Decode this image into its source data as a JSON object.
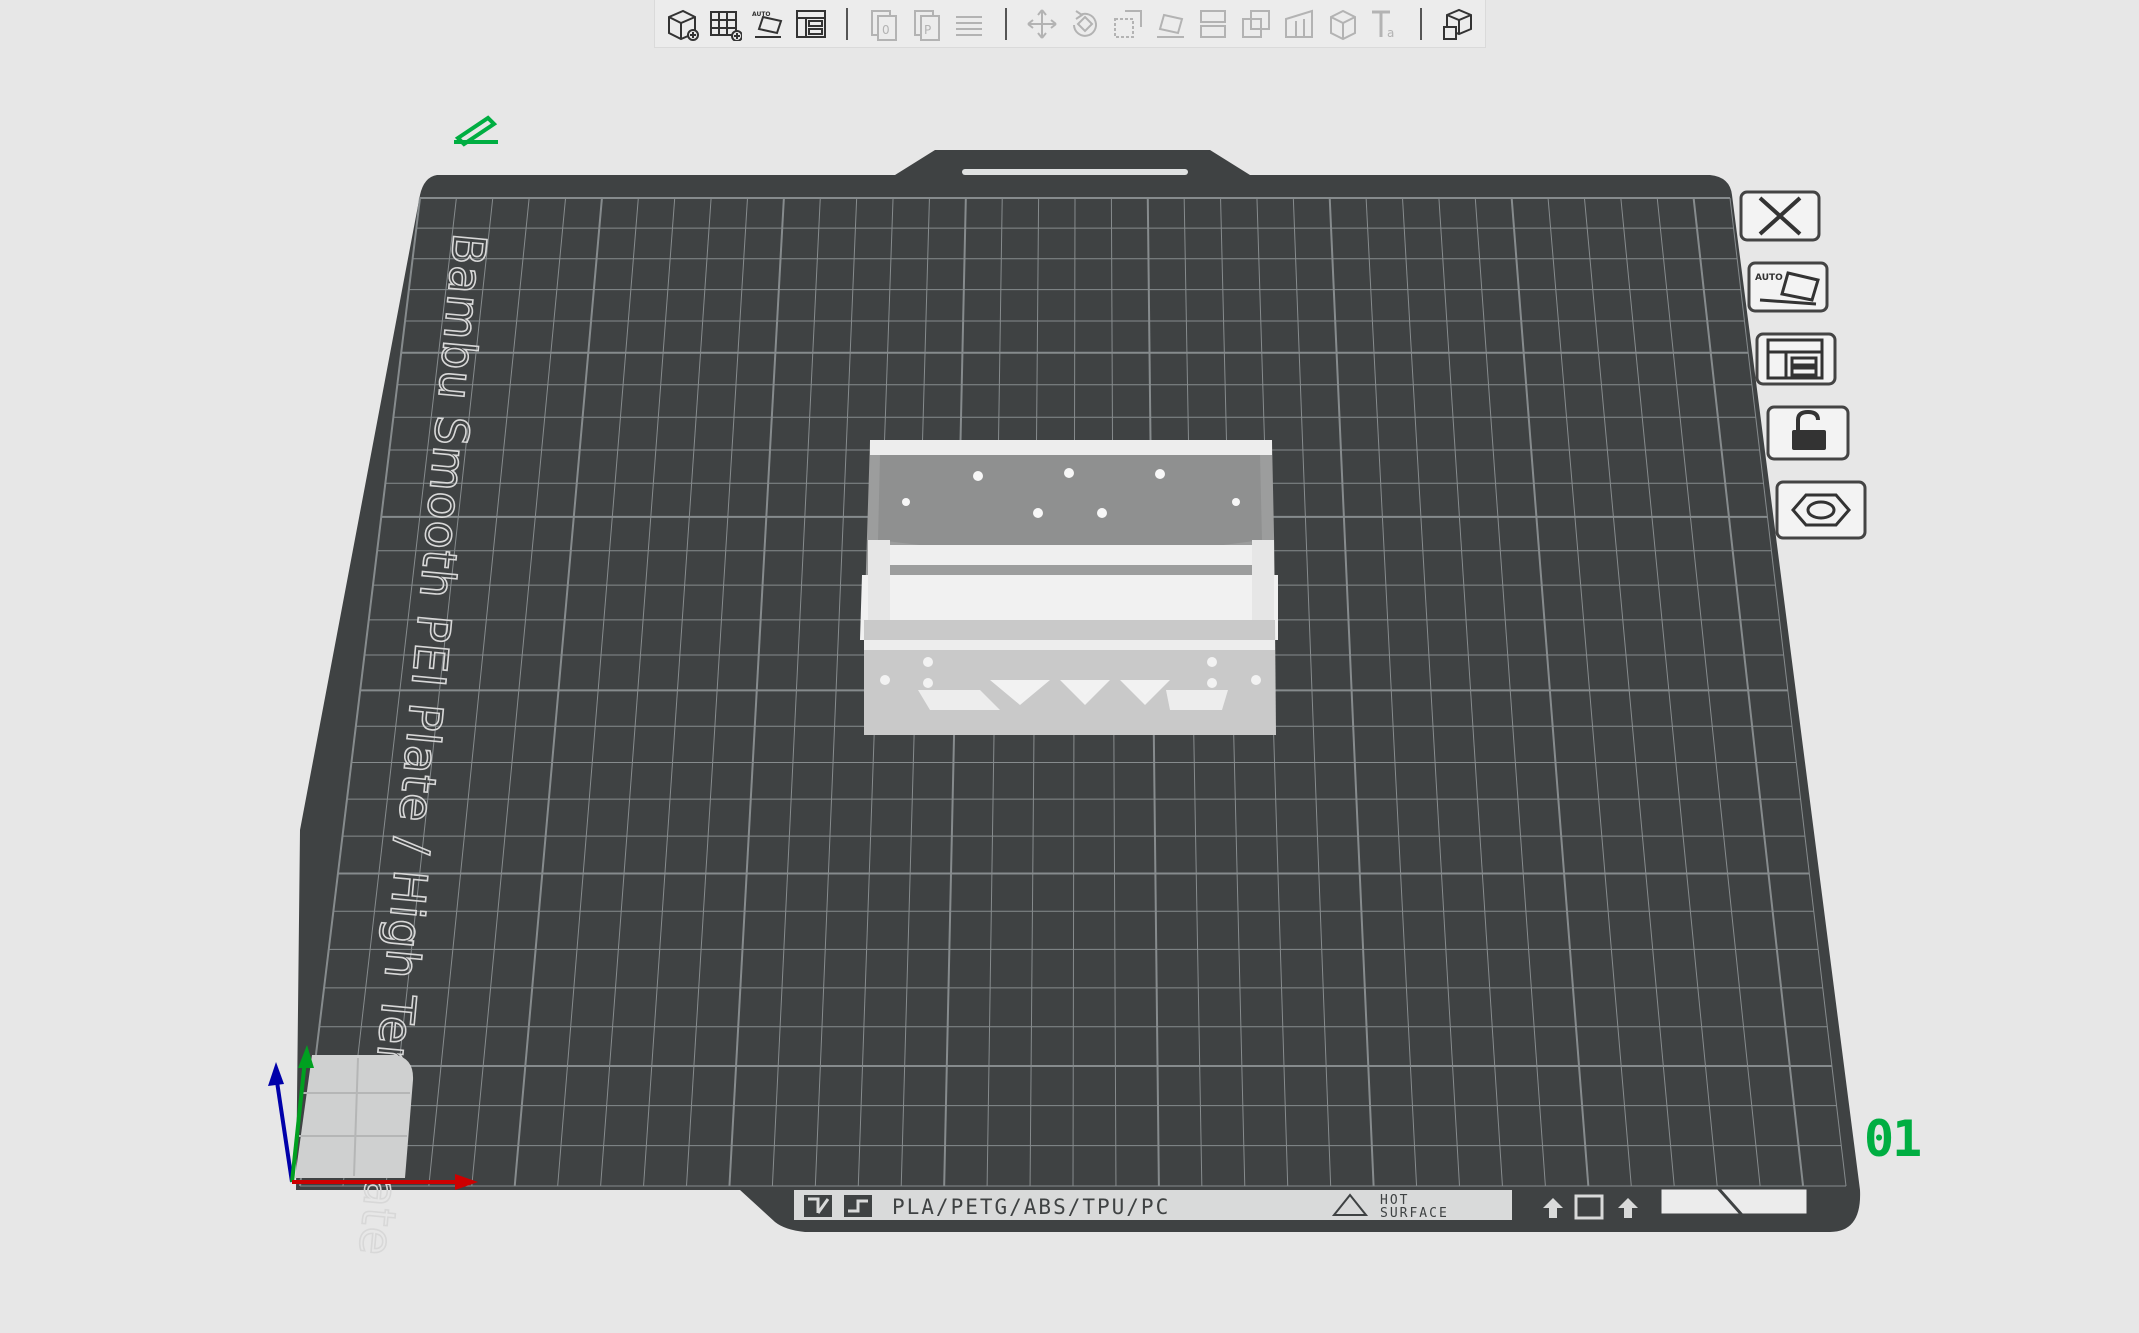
{
  "toolbar": {
    "buttons": [
      {
        "name": "add-object-button",
        "tooltip": "Add",
        "enabled": true
      },
      {
        "name": "add-plate-button",
        "tooltip": "Add plate",
        "enabled": true
      },
      {
        "name": "auto-orient-button",
        "tooltip": "Auto orient",
        "enabled": true,
        "badge": "AUTO"
      },
      {
        "name": "arrange-button",
        "tooltip": "Arrange",
        "enabled": true
      },
      {
        "name": "copy-button",
        "tooltip": "Copy",
        "enabled": false
      },
      {
        "name": "paste-button",
        "tooltip": "Paste",
        "enabled": false
      },
      {
        "name": "layers-button",
        "tooltip": "Layers",
        "enabled": false
      },
      {
        "name": "move-button",
        "tooltip": "Move",
        "enabled": false
      },
      {
        "name": "rotate-button",
        "tooltip": "Rotate",
        "enabled": false
      },
      {
        "name": "scale-button",
        "tooltip": "Scale",
        "enabled": false
      },
      {
        "name": "lay-on-face-button",
        "tooltip": "Lay on face",
        "enabled": false
      },
      {
        "name": "cut-button",
        "tooltip": "Cut",
        "enabled": false
      },
      {
        "name": "boolean-button",
        "tooltip": "Mesh boolean",
        "enabled": false
      },
      {
        "name": "support-paint-button",
        "tooltip": "Support painting",
        "enabled": false
      },
      {
        "name": "seam-paint-button",
        "tooltip": "Seam painting",
        "enabled": false
      },
      {
        "name": "text-button",
        "tooltip": "Text shape",
        "enabled": false
      },
      {
        "name": "assembly-view-button",
        "tooltip": "Assembly view",
        "enabled": true
      }
    ]
  },
  "plate": {
    "type_label": "Bambu Smooth PEI Plate / High Temp Plate",
    "materials": "PLA/PETG/ABS/TPU/PC",
    "hot_surface_line1": "HOT",
    "hot_surface_line2": "SURFACE",
    "plate_number": "01",
    "bed_color": "#3f4243",
    "grid_color": "#868b8d",
    "accent_green": "#00ae42"
  },
  "plate_side_buttons": [
    {
      "name": "delete-plate-button",
      "icon": "close-icon"
    },
    {
      "name": "arrange-plate-button",
      "icon": "auto-orient-icon",
      "badge": "AUTO"
    },
    {
      "name": "plate-arrange-layout-button",
      "icon": "arrange-icon"
    },
    {
      "name": "lock-plate-button",
      "icon": "lock-icon"
    },
    {
      "name": "plate-settings-button",
      "icon": "hex-settings-icon"
    }
  ],
  "axes": {
    "x_color": "#cc0000",
    "y_color": "#00a020",
    "z_color": "#0000aa"
  }
}
